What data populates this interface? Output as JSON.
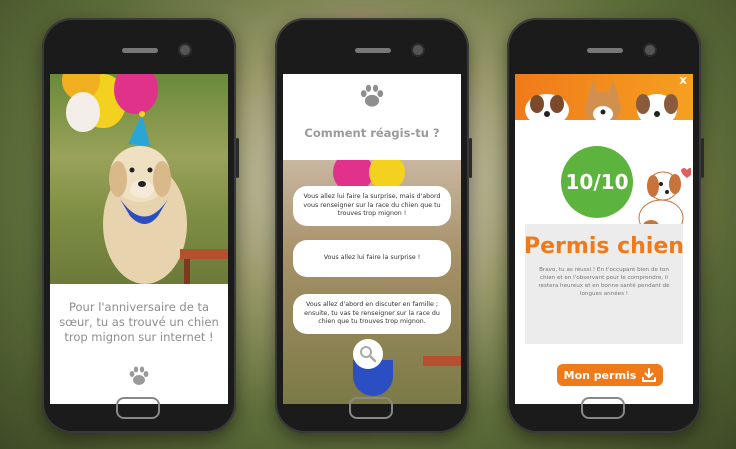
{
  "phone1": {
    "caption": "Pour l'anniversaire de ta sœur, tu as trouvé un chien trop mignon sur internet !"
  },
  "phone2": {
    "question": "Comment réagis-tu ?",
    "choices": [
      "Vous allez lui faire la surprise, mais d'abord vous renseigner sur la race du chien que tu trouves trop mignon !",
      "Vous allez lui faire la surprise !",
      "Vous allez d'abord en discuter en famille ; ensuite, tu vas te renseigner sur la race du chien que tu trouves trop mignon."
    ]
  },
  "phone3": {
    "close": "X",
    "score": "10/10",
    "title": "Permis chien",
    "body": "Bravo, tu as réussi ! En t'occupant bien de ton chien et en l'observant pour le comprendre, il restera heureux et en bonne santé pendant de longues années !",
    "button_label": "Mon permis"
  },
  "colors": {
    "accent": "#f07a1a",
    "success": "#5cb43e",
    "muted_text": "#8e8e8e"
  },
  "icons": [
    "paw-icon",
    "search-icon",
    "download-icon",
    "close-icon"
  ]
}
